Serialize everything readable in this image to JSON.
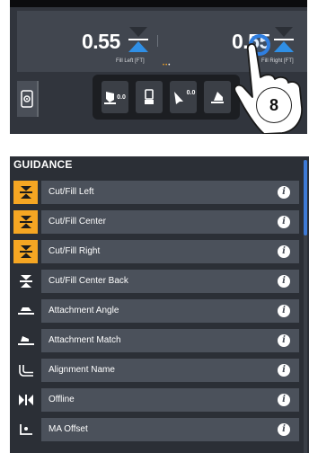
{
  "display": {
    "fill_left": {
      "value": "0.55",
      "label": "Fill Left [FT]"
    },
    "fill_right": {
      "value": "0.55",
      "label": "Fill Right [FT]"
    },
    "page_dots": "•••",
    "toolbar": [
      {
        "name": "machine-depth-button",
        "text": "0.0"
      },
      {
        "name": "machine-button",
        "text": ""
      },
      {
        "name": "offset-button",
        "text": "0.0"
      },
      {
        "name": "attachment-button",
        "text": ""
      }
    ],
    "step_badge": "8"
  },
  "guidance": {
    "title": "GUIDANCE",
    "items": [
      {
        "label": "Cut/Fill Left",
        "active": true,
        "icon": "cut-fill-icon"
      },
      {
        "label": "Cut/Fill Center",
        "active": true,
        "icon": "cut-fill-icon"
      },
      {
        "label": "Cut/Fill Right",
        "active": true,
        "icon": "cut-fill-icon"
      },
      {
        "label": "Cut/Fill Center Back",
        "active": false,
        "icon": "cut-fill-icon"
      },
      {
        "label": "Attachment Angle",
        "active": false,
        "icon": "attachment-angle-icon"
      },
      {
        "label": "Attachment Match",
        "active": false,
        "icon": "attachment-match-icon"
      },
      {
        "label": "Alignment Name",
        "active": false,
        "icon": "alignment-icon"
      },
      {
        "label": "Offline",
        "active": false,
        "icon": "offline-icon"
      },
      {
        "label": "MA Offset",
        "active": false,
        "icon": "ma-offset-icon"
      }
    ],
    "info_glyph": "i"
  },
  "colors": {
    "accent": "#f5a623",
    "blue": "#2f7ee0",
    "panel": "#2b2f36",
    "row": "#4b515b"
  }
}
